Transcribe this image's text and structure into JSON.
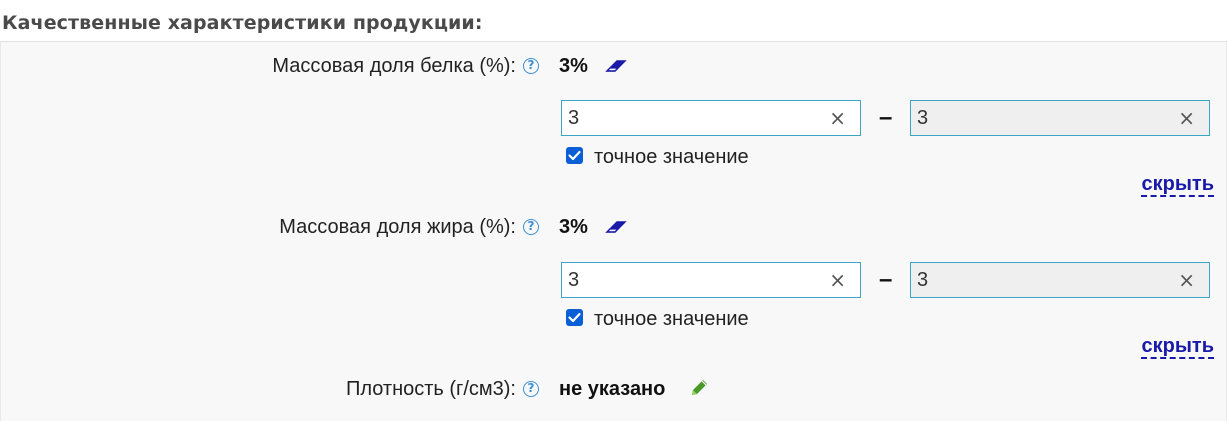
{
  "section": {
    "title": "Качественные характеристики продукции:"
  },
  "fields": [
    {
      "label": "Массовая доля белка (%):",
      "value": "3%",
      "min_value": "3",
      "max_value": "3",
      "exact_label": "точное значение",
      "exact_checked": true,
      "hide_label": "скрыть"
    },
    {
      "label": "Массовая доля жира (%):",
      "value": "3%",
      "min_value": "3",
      "max_value": "3",
      "exact_label": "точное значение",
      "exact_checked": true,
      "hide_label": "скрыть"
    },
    {
      "label": "Плотность (г/см3):",
      "value": "не указано"
    }
  ],
  "symbols": {
    "help": "?",
    "clear": "×",
    "range_dash": "–"
  },
  "colors": {
    "link": "#1a1aa8",
    "input_border": "#3aa6c4",
    "help_icon": "#3d8fd4",
    "checkbox": "#0a5fd6",
    "edit_icon": "#4a9a2a",
    "eraser_icon": "#1a1aa8"
  },
  "icons": {
    "help": "question-circle-icon",
    "eraser": "eraser-icon",
    "edit": "pencil-icon",
    "clear": "clear-x-icon",
    "checkbox": "checkmark-icon"
  }
}
